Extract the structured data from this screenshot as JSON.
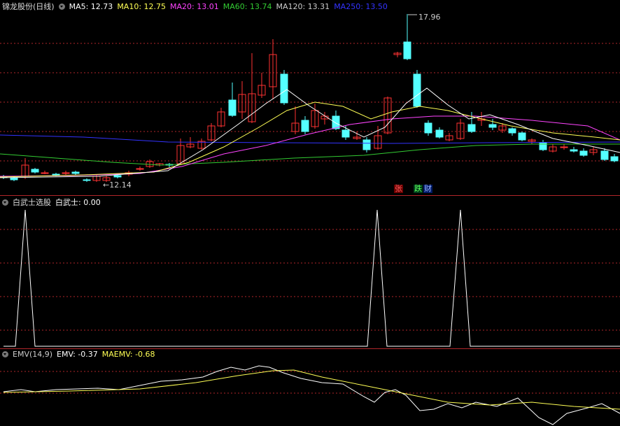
{
  "price_panel": {
    "title": "锦龙股份(日线)",
    "ma_labels": [
      {
        "text": "MA5: 12.73",
        "color": "#ffffff"
      },
      {
        "text": "MA10: 12.75",
        "color": "#ffff55"
      },
      {
        "text": "MA20: 13.01",
        "color": "#ff44ff"
      },
      {
        "text": "MA60: 13.74",
        "color": "#33cc33"
      },
      {
        "text": "MA120: 13.31",
        "color": "#cccccc"
      },
      {
        "text": "MA250: 13.50",
        "color": "#3333ff"
      }
    ],
    "high_label": "17.96",
    "low_label": "12.14",
    "badges": {
      "zhang": "张",
      "die": "跌",
      "cai": "财"
    }
  },
  "signal_panel": {
    "title": "白武士选股",
    "value_label": "白武士: 0.00"
  },
  "emv_panel": {
    "title": "EMV(14,9)",
    "emv_label": "EMV: -0.37",
    "maemv_label": "MAEMV: -0.68"
  },
  "colors": {
    "up": "#ff3232",
    "down": "#54ffff",
    "grid": "#b0262a"
  }
}
